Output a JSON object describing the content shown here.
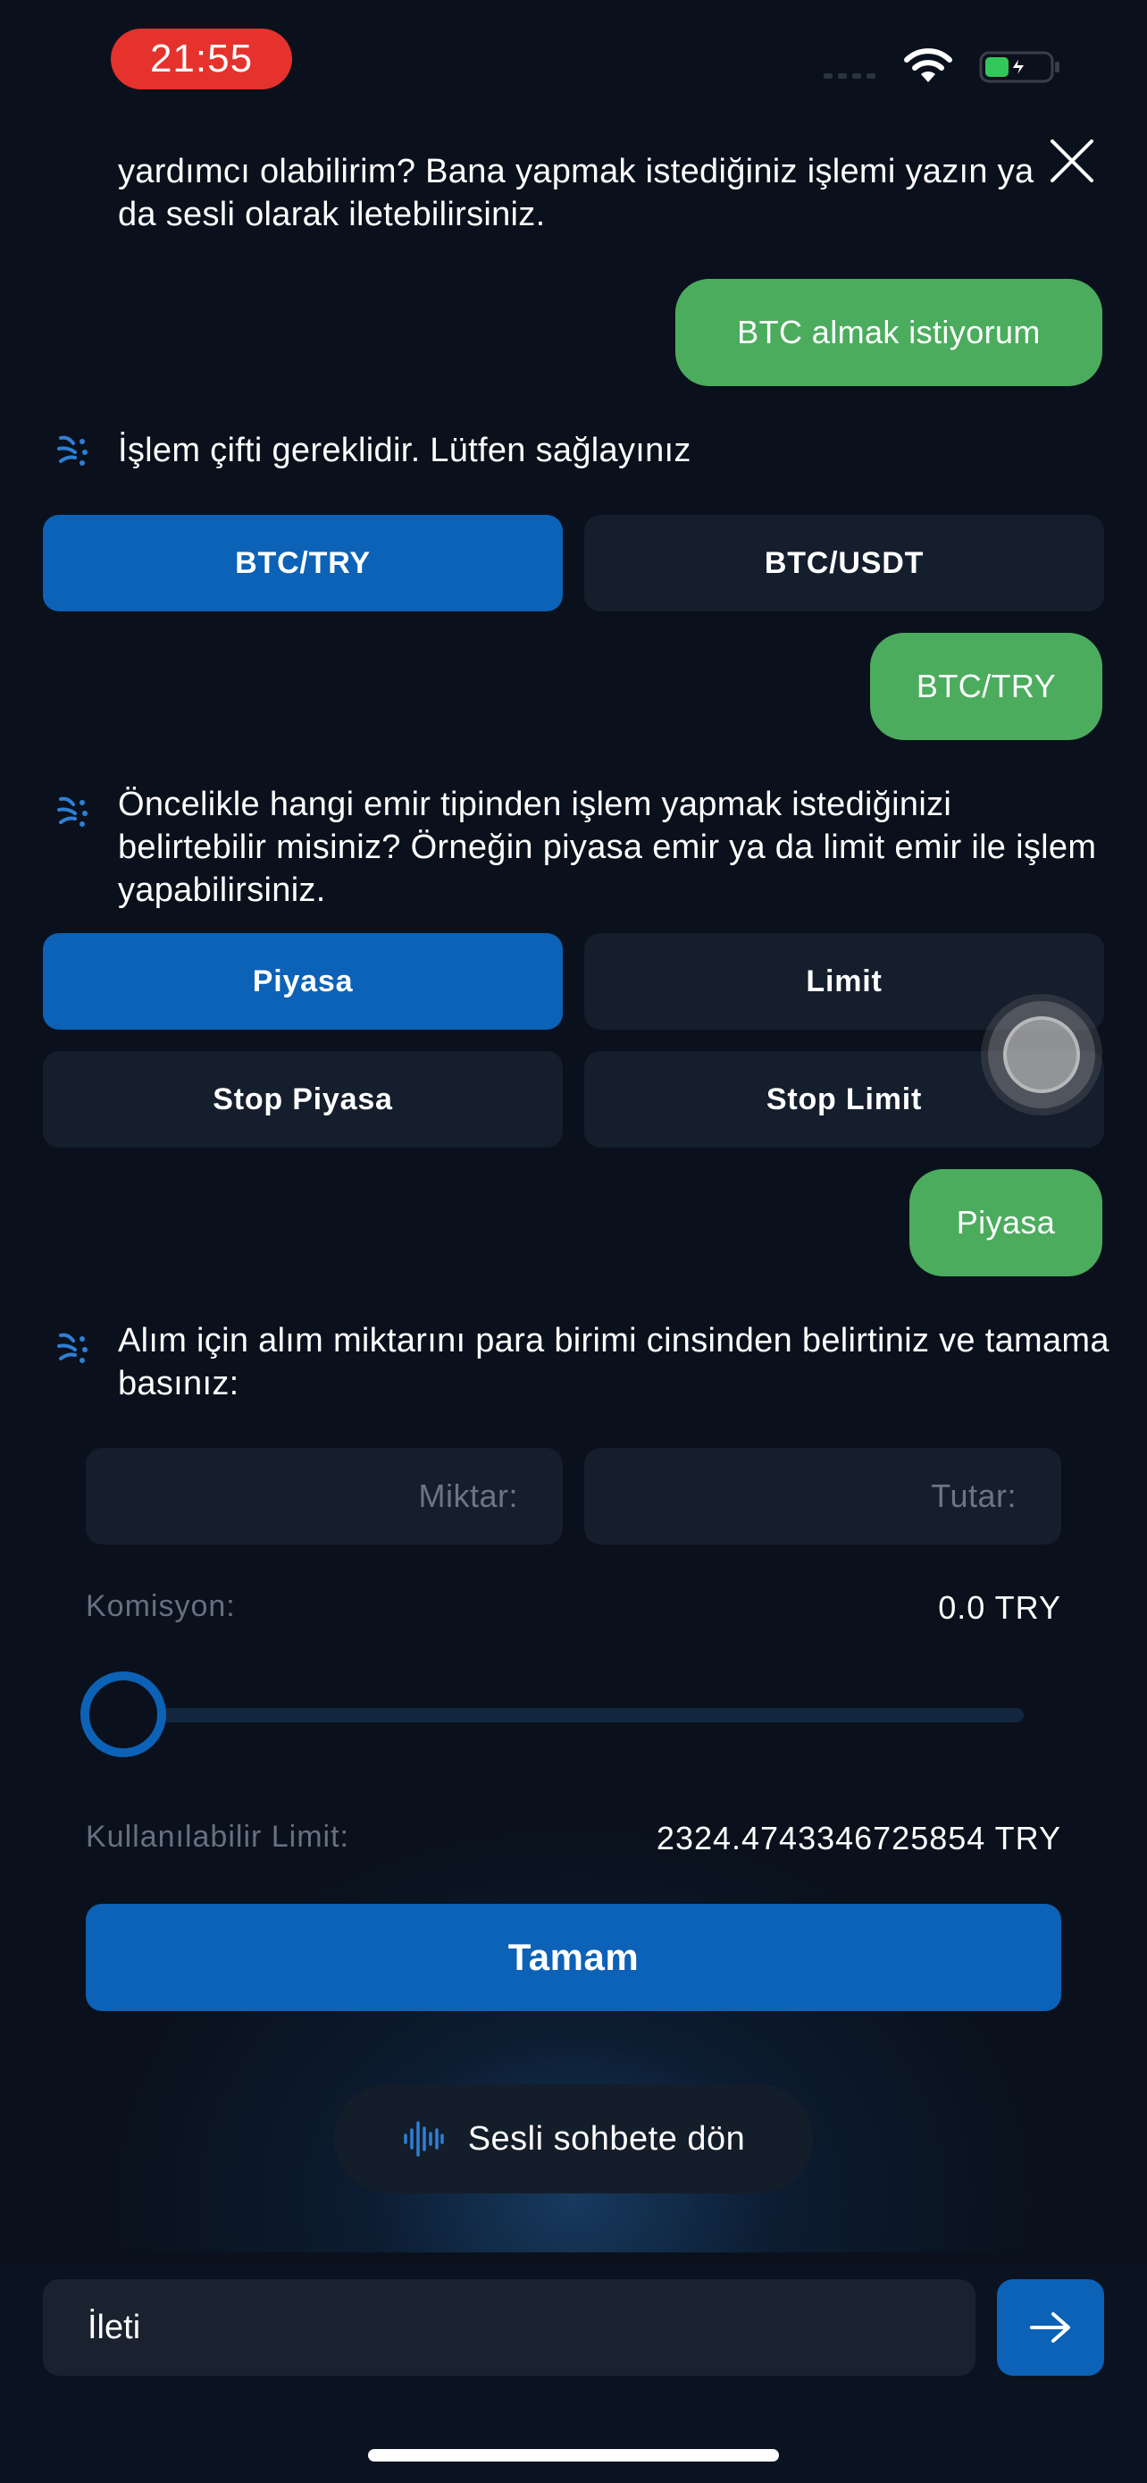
{
  "status_bar": {
    "time": "21:55"
  },
  "chat": {
    "intro_text": "yardımcı olabilirim? Bana yapmak istediğiniz işlemi yazın ya da sesli olarak iletebilirsiniz.",
    "user_msg_1": "BTC almak istiyorum",
    "bot_msg_pair": "İşlem çifti gereklidir. Lütfen sağlayınız",
    "pair_options": [
      "BTC/TRY",
      "BTC/USDT"
    ],
    "user_msg_2": "BTC/TRY",
    "bot_msg_order_type": "Öncelikle hangi emir tipinden işlem yapmak istediğinizi belirtebilir misiniz? Örneğin piyasa emir ya da limit emir ile işlem yapabilirsiniz.",
    "order_options": [
      "Piyasa",
      "Limit",
      "Stop Piyasa",
      "Stop Limit"
    ],
    "user_msg_3": "Piyasa",
    "bot_msg_amount": "Alım için alım miktarını para birimi cinsinden belirtiniz ve tamama basınız:"
  },
  "order_form": {
    "amount_placeholder": "Miktar:",
    "total_placeholder": "Tutar:",
    "commission_label": "Komisyon:",
    "commission_value": "0.0 TRY",
    "slider_value": 0,
    "limit_label": "Kullanılabilir Limit:",
    "limit_value": "2324.4743346725854 TRY",
    "confirm_label": "Tamam"
  },
  "voice_button_label": "Sesli sohbete dön",
  "composer": {
    "placeholder": "İleti"
  },
  "colors": {
    "background": "#0a111c",
    "accent": "#0c62b6",
    "user_bubble": "#4cac5e",
    "card": "#141e2c",
    "status_pill": "#e5322d"
  },
  "icons": [
    "wifi-icon",
    "battery-icon",
    "close-icon",
    "bot-avatar-icon",
    "voice-wave-icon",
    "arrow-right-icon"
  ]
}
